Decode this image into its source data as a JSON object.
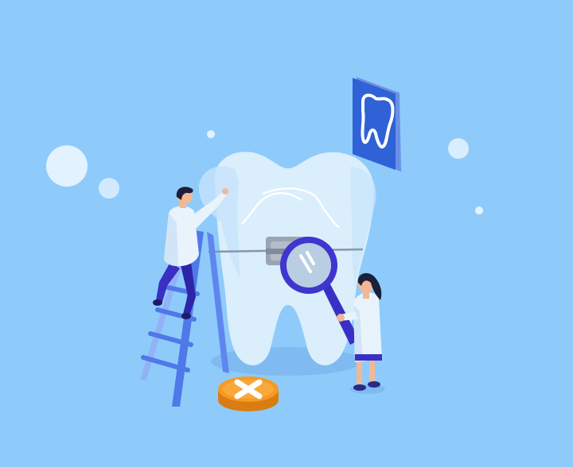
{
  "scene": {
    "background_color": "#8ecbfb",
    "tooth_color": "#daeefc",
    "sign_color": "#2f62d6",
    "accent_color": "#f59b22",
    "figure_coat_color": "#e9f3fc",
    "figure_pants_color": "#3a2fc4",
    "ladder_color": "#5f86ee",
    "icons": [
      "tooth-sign-icon",
      "magnifying-glass-icon",
      "close-x-icon",
      "ladder-icon"
    ]
  }
}
